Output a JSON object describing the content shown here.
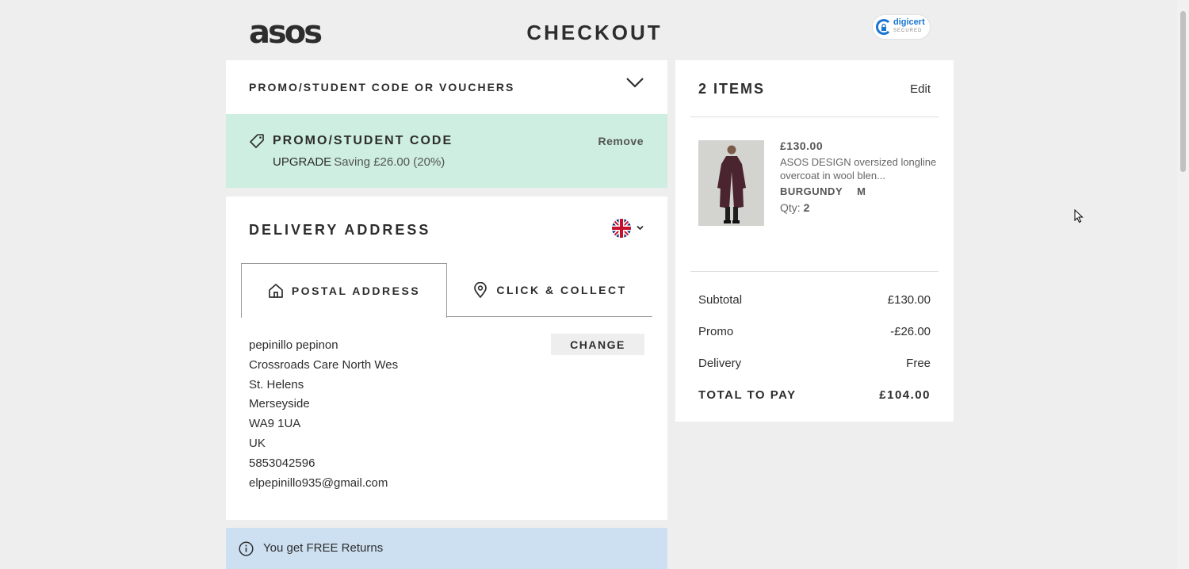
{
  "header": {
    "logo_text": "asos",
    "title": "CHECKOUT",
    "badge": {
      "brand": "digicert",
      "sub": "SECURED"
    }
  },
  "promo_bar": {
    "label": "PROMO/STUDENT CODE OR VOUCHERS",
    "icon": "chevron-down-icon"
  },
  "promo_applied": {
    "title": "PROMO/STUDENT CODE",
    "remove_label": "Remove",
    "code": "UPGRADE",
    "saving": "Saving £26.00 (20%)",
    "bg_color": "#cdeee0"
  },
  "delivery": {
    "heading": "DELIVERY ADDRESS",
    "country_flag": "uk-flag-icon",
    "tabs": [
      {
        "label": "POSTAL ADDRESS",
        "icon": "home-icon",
        "active": true
      },
      {
        "label": "CLICK & COLLECT",
        "icon": "location-pin-icon",
        "active": false
      }
    ],
    "change_label": "CHANGE",
    "address_lines": [
      "pepinillo pepinon",
      "Crossroads Care North Wes",
      "St. Helens",
      "Merseyside",
      "WA9 1UA",
      "UK",
      "5853042596",
      "elpepinillo935@gmail.com"
    ]
  },
  "returns_notice": {
    "text": "You get FREE Returns",
    "icon": "info-icon",
    "bg_color": "#cde0f2"
  },
  "summary": {
    "items_title": "2 ITEMS",
    "edit_label": "Edit",
    "product": {
      "price": "£130.00",
      "name": "ASOS DESIGN oversized longline overcoat in wool blen...",
      "colour": "BURGUNDY",
      "size": "M",
      "qty_label": "Qty:",
      "qty": "2"
    },
    "rows": [
      {
        "label": "Subtotal",
        "value": "£130.00"
      },
      {
        "label": "Promo",
        "value": "-£26.00"
      },
      {
        "label": "Delivery",
        "value": "Free"
      }
    ],
    "total": {
      "label": "TOTAL TO PAY",
      "value": "£104.00"
    }
  }
}
